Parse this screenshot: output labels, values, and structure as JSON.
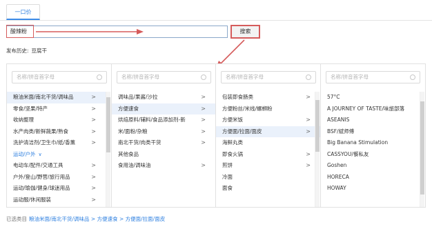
{
  "tabs": [
    {
      "label": "一口价"
    }
  ],
  "search": {
    "value": "酸辣粉",
    "button_label": "搜索"
  },
  "history": {
    "label": "发布历史:",
    "keyword": "豆腐干"
  },
  "columns": [
    {
      "search_placeholder": "名称/拼音首字母",
      "items": [
        {
          "label": "粮油米面/南北干货/调味品",
          "chevron": ">",
          "selected": true
        },
        {
          "label": "零食/坚果/特产",
          "chevron": ">"
        },
        {
          "label": "收纳整理",
          "chevron": ">"
        },
        {
          "label": "水产肉类/新鲜蔬果/熟食",
          "chevron": ">"
        },
        {
          "label": "洗护清洁剂/卫生巾/纸/香薰",
          "chevron": ">"
        },
        {
          "label": "运动/户外",
          "group": true,
          "chevron": "∨"
        },
        {
          "label": "电动车/配件/交通工具",
          "chevron": ">"
        },
        {
          "label": "户外/登山/野营/旅行用品",
          "chevron": ">"
        },
        {
          "label": "运动/瑜伽/健身/球迷用品",
          "chevron": ">"
        },
        {
          "label": "运动服/休闲服装",
          "chevron": ">"
        }
      ]
    },
    {
      "search_placeholder": "名称/拼音首字母",
      "items": [
        {
          "label": "调味品/果酱/沙拉",
          "chevron": ">"
        },
        {
          "label": "方便速食",
          "chevron": ">",
          "selected": true
        },
        {
          "label": "烘焙原料/辅料/食品添加剂-新",
          "chevron": ">"
        },
        {
          "label": "米/面粉/杂粮",
          "chevron": ">"
        },
        {
          "label": "南北干货/肉类干货",
          "chevron": ">"
        },
        {
          "label": "其他食品",
          "chevron": ""
        },
        {
          "label": "食用油/调味油",
          "chevron": ">"
        }
      ]
    },
    {
      "search_placeholder": "名称/拼音首字母",
      "items": [
        {
          "label": "包装即食肠类",
          "chevron": ">"
        },
        {
          "label": "方便粉丝/米线/螺蛳粉",
          "chevron": ""
        },
        {
          "label": "方便米饭",
          "chevron": ">"
        },
        {
          "label": "方便面/拉面/面皮",
          "chevron": ">",
          "selected": true
        },
        {
          "label": "海鲜丸类",
          "chevron": ""
        },
        {
          "label": "即食火锅",
          "chevron": ">"
        },
        {
          "label": "煎饼",
          "chevron": ">"
        },
        {
          "label": "冷面",
          "chevron": ""
        },
        {
          "label": "面食",
          "chevron": ""
        }
      ]
    },
    {
      "search_placeholder": "名称/拼音首字母",
      "items": [
        {
          "label": "57°C",
          "chevron": ""
        },
        {
          "label": "A JOURNEY OF TASTE/味旅部落",
          "chevron": ""
        },
        {
          "label": "ASEANIS",
          "chevron": ""
        },
        {
          "label": "BSF/斌师傅",
          "chevron": ""
        },
        {
          "label": "Big Banana Stimulation",
          "chevron": ""
        },
        {
          "label": "CASSYOU/餐私友",
          "chevron": ""
        },
        {
          "label": "Goshen",
          "chevron": ""
        },
        {
          "label": "HORECA",
          "chevron": ""
        },
        {
          "label": "HOWAY",
          "chevron": ""
        }
      ]
    }
  ],
  "footer": {
    "label": "已选类目",
    "path": "粮油米面/南北干货/调味品 > 方便速食 > 方便面/拉面/面皮"
  },
  "colors": {
    "accent": "#2f80e0",
    "annotation": "#d55b5b",
    "selected_bg": "#eaf1fb"
  }
}
